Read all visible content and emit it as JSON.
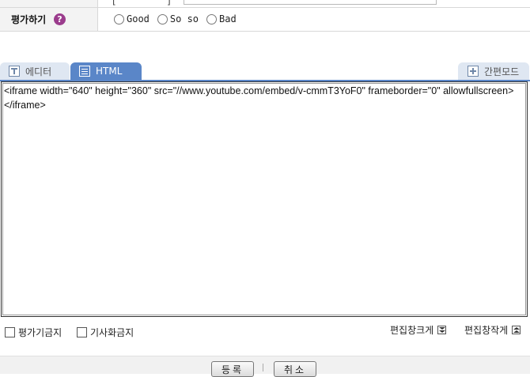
{
  "rating": {
    "label": "평가하기",
    "help_glyph": "?",
    "options": [
      "Good",
      "So so",
      "Bad"
    ]
  },
  "top_strip": {
    "bracket_left": "[",
    "bracket_right": "]"
  },
  "tabs": {
    "editor": "에디터",
    "html": "HTML",
    "simple_mode": "간편모드"
  },
  "editor": {
    "content": "<iframe width=\"640\" height=\"360\" src=\"//www.youtube.com/embed/v-cmmT3YoF0\" frameborder=\"0\" allowfullscreen></iframe>"
  },
  "options": {
    "no_rating": "평가기금지",
    "no_article": "기사화금지",
    "enlarge": "편집창크게",
    "shrink": "편집창작게"
  },
  "footer": {
    "submit": "등록",
    "cancel": "취소"
  },
  "colors": {
    "tab_active": "#5a86c8",
    "tab_inactive": "#dfe7f2",
    "help_icon": "#9b3c8d"
  }
}
